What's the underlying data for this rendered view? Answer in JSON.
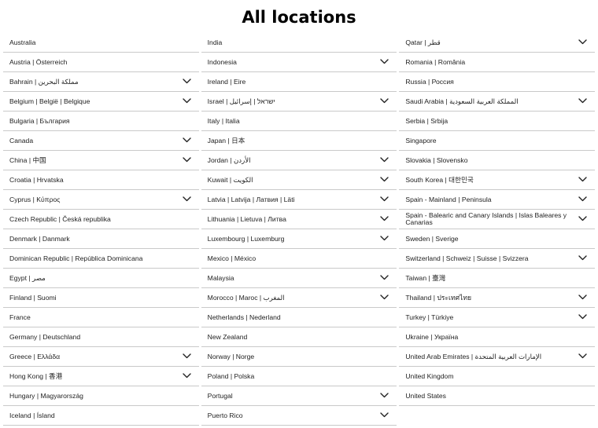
{
  "page_title": "All locations",
  "columns": [
    [
      {
        "label": "Australia",
        "expandable": false
      },
      {
        "label": "Austria | Österreich",
        "expandable": false
      },
      {
        "label": "Bahrain | مملكة البحرين",
        "expandable": true
      },
      {
        "label": "Belgium | België | Belgique",
        "expandable": true
      },
      {
        "label": "Bulgaria | България",
        "expandable": false
      },
      {
        "label": "Canada",
        "expandable": true
      },
      {
        "label": "China | 中国",
        "expandable": true
      },
      {
        "label": "Croatia | Hrvatska",
        "expandable": false
      },
      {
        "label": "Cyprus | Κύπρος",
        "expandable": true
      },
      {
        "label": "Czech Republic | Česká republika",
        "expandable": false
      },
      {
        "label": "Denmark | Danmark",
        "expandable": false
      },
      {
        "label": "Dominican Republic | República Dominicana",
        "expandable": false
      },
      {
        "label": "Egypt | مصر",
        "expandable": false
      },
      {
        "label": "Finland | Suomi",
        "expandable": false
      },
      {
        "label": "France",
        "expandable": false
      },
      {
        "label": "Germany | Deutschland",
        "expandable": false
      },
      {
        "label": "Greece | Ελλάδα",
        "expandable": true
      },
      {
        "label": "Hong Kong | 香港",
        "expandable": true
      },
      {
        "label": "Hungary | Magyarország",
        "expandable": false
      },
      {
        "label": "Iceland | Ísland",
        "expandable": false
      }
    ],
    [
      {
        "label": "India",
        "expandable": false
      },
      {
        "label": "Indonesia",
        "expandable": true
      },
      {
        "label": "Ireland | Eire",
        "expandable": false
      },
      {
        "label": "Israel | ישראל | إسرائيل",
        "expandable": true
      },
      {
        "label": "Italy | Italia",
        "expandable": false
      },
      {
        "label": "Japan | 日本",
        "expandable": false
      },
      {
        "label": "Jordan | الأردن",
        "expandable": true
      },
      {
        "label": "Kuwait | الكويت",
        "expandable": true
      },
      {
        "label": "Latvia | Latvija | Латвия | Läti",
        "expandable": true
      },
      {
        "label": "Lithuania | Lietuva | Литва",
        "expandable": true
      },
      {
        "label": "Luxembourg | Luxemburg",
        "expandable": true
      },
      {
        "label": "Mexico | México",
        "expandable": false
      },
      {
        "label": "Malaysia",
        "expandable": true
      },
      {
        "label": "Morocco | Maroc | المغرب",
        "expandable": true
      },
      {
        "label": "Netherlands | Nederland",
        "expandable": false
      },
      {
        "label": "New Zealand",
        "expandable": false
      },
      {
        "label": "Norway | Norge",
        "expandable": false
      },
      {
        "label": "Poland | Polska",
        "expandable": false
      },
      {
        "label": "Portugal",
        "expandable": true
      },
      {
        "label": "Puerto Rico",
        "expandable": true
      }
    ],
    [
      {
        "label": "Qatar | قطر",
        "expandable": true
      },
      {
        "label": "Romania | România",
        "expandable": false
      },
      {
        "label": "Russia | Россия",
        "expandable": false
      },
      {
        "label": "Saudi Arabia | المملكة العربية السعودية",
        "expandable": true
      },
      {
        "label": "Serbia | Srbija",
        "expandable": false
      },
      {
        "label": "Singapore",
        "expandable": false
      },
      {
        "label": "Slovakia | Slovensko",
        "expandable": false
      },
      {
        "label": "South Korea | 대한민국",
        "expandable": true
      },
      {
        "label": "Spain - Mainland | Peninsula",
        "expandable": true
      },
      {
        "label": "Spain - Balearic and Canary Islands | Islas Baleares y Canarias",
        "expandable": true
      },
      {
        "label": "Sweden | Sverige",
        "expandable": false
      },
      {
        "label": "Switzerland | Schweiz | Suisse | Svizzera",
        "expandable": true
      },
      {
        "label": "Taiwan | 臺灣",
        "expandable": false
      },
      {
        "label": "Thailand | ประเทศไทย",
        "expandable": true
      },
      {
        "label": "Turkey | Türkiye",
        "expandable": true
      },
      {
        "label": "Ukraine | Україна",
        "expandable": false
      },
      {
        "label": "United Arab Emirates | الإمارات العربية المتحدة",
        "expandable": true
      },
      {
        "label": "United Kingdom",
        "expandable": false
      },
      {
        "label": "United States",
        "expandable": false
      }
    ]
  ],
  "icons": {
    "expand": "chevron-down-icon"
  },
  "colors": {
    "divider": "#c9c9c9",
    "text": "#222222",
    "title": "#000000"
  }
}
